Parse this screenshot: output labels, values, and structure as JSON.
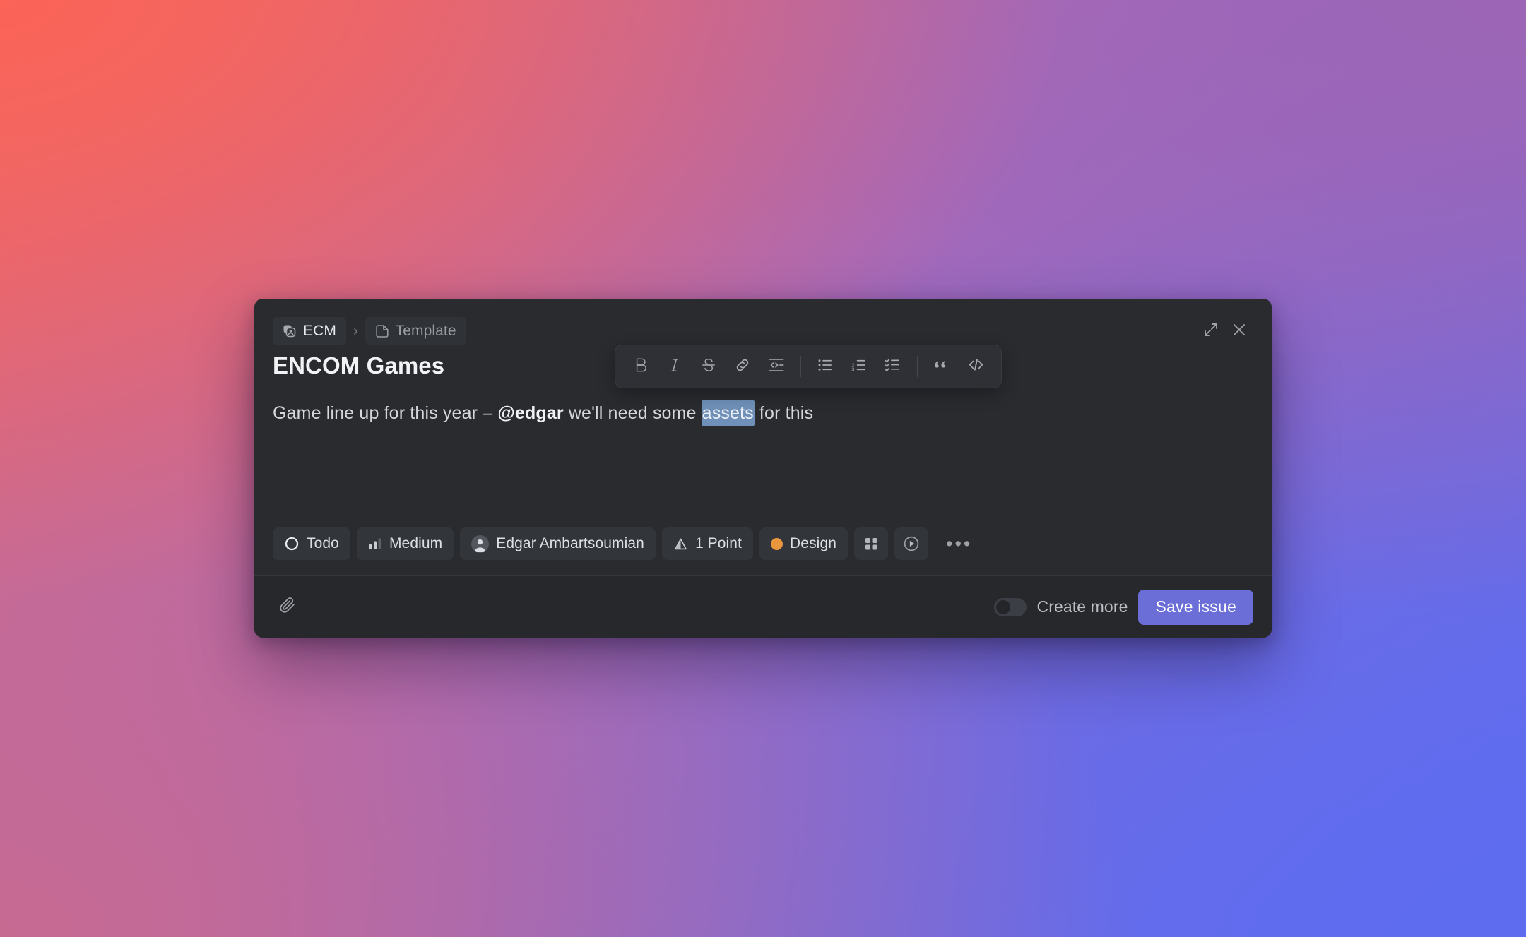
{
  "window": {
    "breadcrumb": {
      "project": "ECM",
      "separator": "›",
      "template": "Template"
    },
    "actions": {
      "expand": "expand-icon",
      "close": "close-icon"
    }
  },
  "issue": {
    "title": "ENCOM Games",
    "description": {
      "before": "Game line up for this year – ",
      "mention": "@edgar",
      "middle": " we'll need some ",
      "selected": "assets",
      "after": " for this"
    }
  },
  "toolbar": {
    "items": [
      {
        "name": "bold",
        "glyph": "B"
      },
      {
        "name": "italic",
        "glyph": "I"
      },
      {
        "name": "strikethrough",
        "glyph": "S"
      },
      {
        "name": "link",
        "glyph": "link"
      },
      {
        "name": "inline-code",
        "glyph": "code-line"
      },
      {
        "name": "bulleted-list",
        "glyph": "bullets"
      },
      {
        "name": "numbered-list",
        "glyph": "numbers"
      },
      {
        "name": "todo-list",
        "glyph": "checks"
      },
      {
        "name": "quote",
        "glyph": "quote"
      },
      {
        "name": "code-block",
        "glyph": "code-block"
      }
    ]
  },
  "properties": {
    "status": "Todo",
    "priority": "Medium",
    "assignee": "Edgar Ambartsoumian",
    "estimate": "1 Point",
    "label": "Design",
    "label_color": "#e8973f",
    "project_icon": "grid-icon",
    "cycle_icon": "play-circle-icon",
    "more": "•••"
  },
  "footer": {
    "attach": "paperclip-icon",
    "create_more_label": "Create more",
    "create_more_on": false,
    "save_label": "Save issue",
    "save_color": "#6a6ed6"
  }
}
